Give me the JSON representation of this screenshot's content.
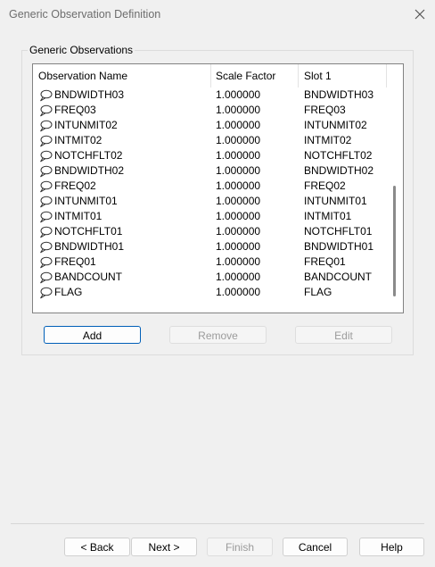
{
  "window": {
    "title": "Generic Observation Definition"
  },
  "group": {
    "label": "Generic Observations"
  },
  "table": {
    "columns": [
      "Observation Name",
      "Scale Factor",
      "Slot 1"
    ],
    "rows": [
      {
        "name": "BNDWIDTH03",
        "scale": "1.000000",
        "slot": "BNDWIDTH03"
      },
      {
        "name": "FREQ03",
        "scale": "1.000000",
        "slot": "FREQ03"
      },
      {
        "name": "INTUNMIT02",
        "scale": "1.000000",
        "slot": "INTUNMIT02"
      },
      {
        "name": "INTMIT02",
        "scale": "1.000000",
        "slot": "INTMIT02"
      },
      {
        "name": "NOTCHFLT02",
        "scale": "1.000000",
        "slot": "NOTCHFLT02"
      },
      {
        "name": "BNDWIDTH02",
        "scale": "1.000000",
        "slot": "BNDWIDTH02"
      },
      {
        "name": "FREQ02",
        "scale": "1.000000",
        "slot": "FREQ02"
      },
      {
        "name": "INTUNMIT01",
        "scale": "1.000000",
        "slot": "INTUNMIT01"
      },
      {
        "name": "INTMIT01",
        "scale": "1.000000",
        "slot": "INTMIT01"
      },
      {
        "name": "NOTCHFLT01",
        "scale": "1.000000",
        "slot": "NOTCHFLT01"
      },
      {
        "name": "BNDWIDTH01",
        "scale": "1.000000",
        "slot": "BNDWIDTH01"
      },
      {
        "name": "FREQ01",
        "scale": "1.000000",
        "slot": "FREQ01"
      },
      {
        "name": "BANDCOUNT",
        "scale": "1.000000",
        "slot": "BANDCOUNT"
      },
      {
        "name": "FLAG",
        "scale": "1.000000",
        "slot": "FLAG"
      }
    ],
    "row_icon": "observation-icon"
  },
  "actions": {
    "add": "Add",
    "remove": "Remove",
    "edit": "Edit"
  },
  "footer": {
    "back": "< Back",
    "next": "Next >",
    "finish": "Finish",
    "cancel": "Cancel",
    "help": "Help"
  }
}
